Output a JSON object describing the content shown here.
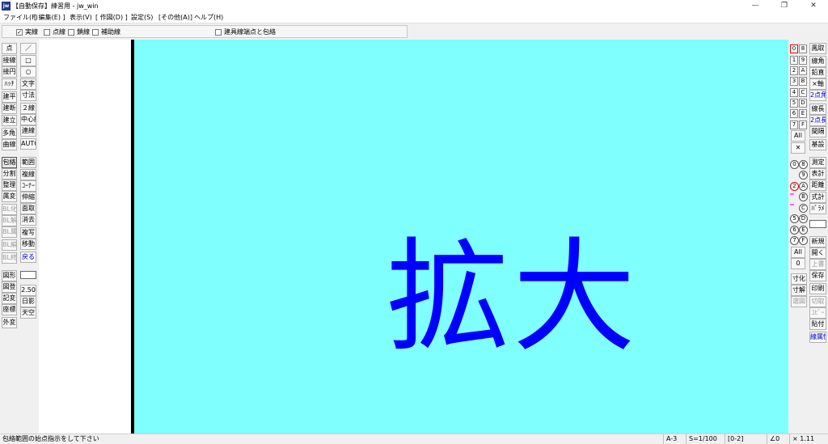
{
  "window": {
    "icon_text": "jw",
    "title": "【自動保存】練習用 - jw_win",
    "controls": {
      "minimize": "—",
      "maximize": "❐",
      "close": "✕"
    }
  },
  "menu": [
    "ファイル(F)",
    "[ 編集(E) ]",
    "表示(V)",
    "[ 作図(D) ]",
    "設定(S)",
    "[その他(A)]",
    "ヘルプ(H)"
  ],
  "toolbar": {
    "checks": [
      {
        "label": "実線",
        "checked": true
      },
      {
        "label": "点線",
        "checked": false
      },
      {
        "label": "鎖線",
        "checked": false
      },
      {
        "label": "補助線",
        "checked": false
      }
    ],
    "endpoint_check": {
      "label": "建具線端点と包絡",
      "checked": false
    }
  },
  "left_tools": {
    "col1": [
      "点",
      "接線",
      "接円",
      "ﾊｯﾁ",
      "建平",
      "建断",
      "建立",
      "多角形",
      "曲線",
      "包絡",
      "分割",
      "整理",
      "属変",
      "BL化",
      "BL解",
      "BL属",
      "BL編",
      "BL終",
      "図形",
      "図登",
      "記変",
      "座標",
      "外変"
    ],
    "col2": [
      "／",
      "□",
      "○",
      "文字",
      "寸法",
      "２線",
      "中心線",
      "連線",
      "AUTO",
      "範囲",
      "複線",
      "ｺｰﾅｰ",
      "伸縮",
      "面取",
      "消去",
      "複写",
      "移動",
      "戻る",
      "",
      "2.50",
      "日影",
      "天空"
    ]
  },
  "canvas": {
    "text": "拡大",
    "bg": "#80ffff",
    "text_color": "#0000ff"
  },
  "right_tools": {
    "layer_groups": [
      "0",
      "1",
      "2",
      "3",
      "4",
      "5",
      "6",
      "7"
    ],
    "layers": [
      "8",
      "9",
      "A",
      "B",
      "C",
      "D",
      "E",
      "F"
    ],
    "all": "All",
    "x": "✕",
    "col_b_top": [
      "鳳取",
      "線角",
      "鉛直",
      "×軸",
      "2点角",
      "線長",
      "2点長",
      "間隔",
      "基設"
    ],
    "circles_left": [
      "0",
      "",
      "2",
      "",
      "",
      "5",
      "6",
      "7"
    ],
    "circles_right": [
      "8",
      "9",
      "A",
      "B",
      "C",
      "D",
      "E",
      "F"
    ],
    "all2": "All",
    "zero": "0",
    "col_b_mid": [
      "測定",
      "表計",
      "距離",
      "式計",
      "ﾊﾟﾗﾒ"
    ],
    "col_b_low": [
      "新規",
      "開く",
      "上書",
      "保存",
      "印刷",
      "切取",
      "ｺﾋﾟｰ",
      "貼付",
      "線属性"
    ],
    "col_a_low": [
      "寸化",
      "寸解",
      "選図"
    ]
  },
  "status": {
    "message": "包絡範囲の始点指示をして下さい",
    "paper": "A-3",
    "scale": "S=1/100",
    "layer": "[0-2]",
    "angle": "∠0",
    "zoom": "× 1.11"
  }
}
